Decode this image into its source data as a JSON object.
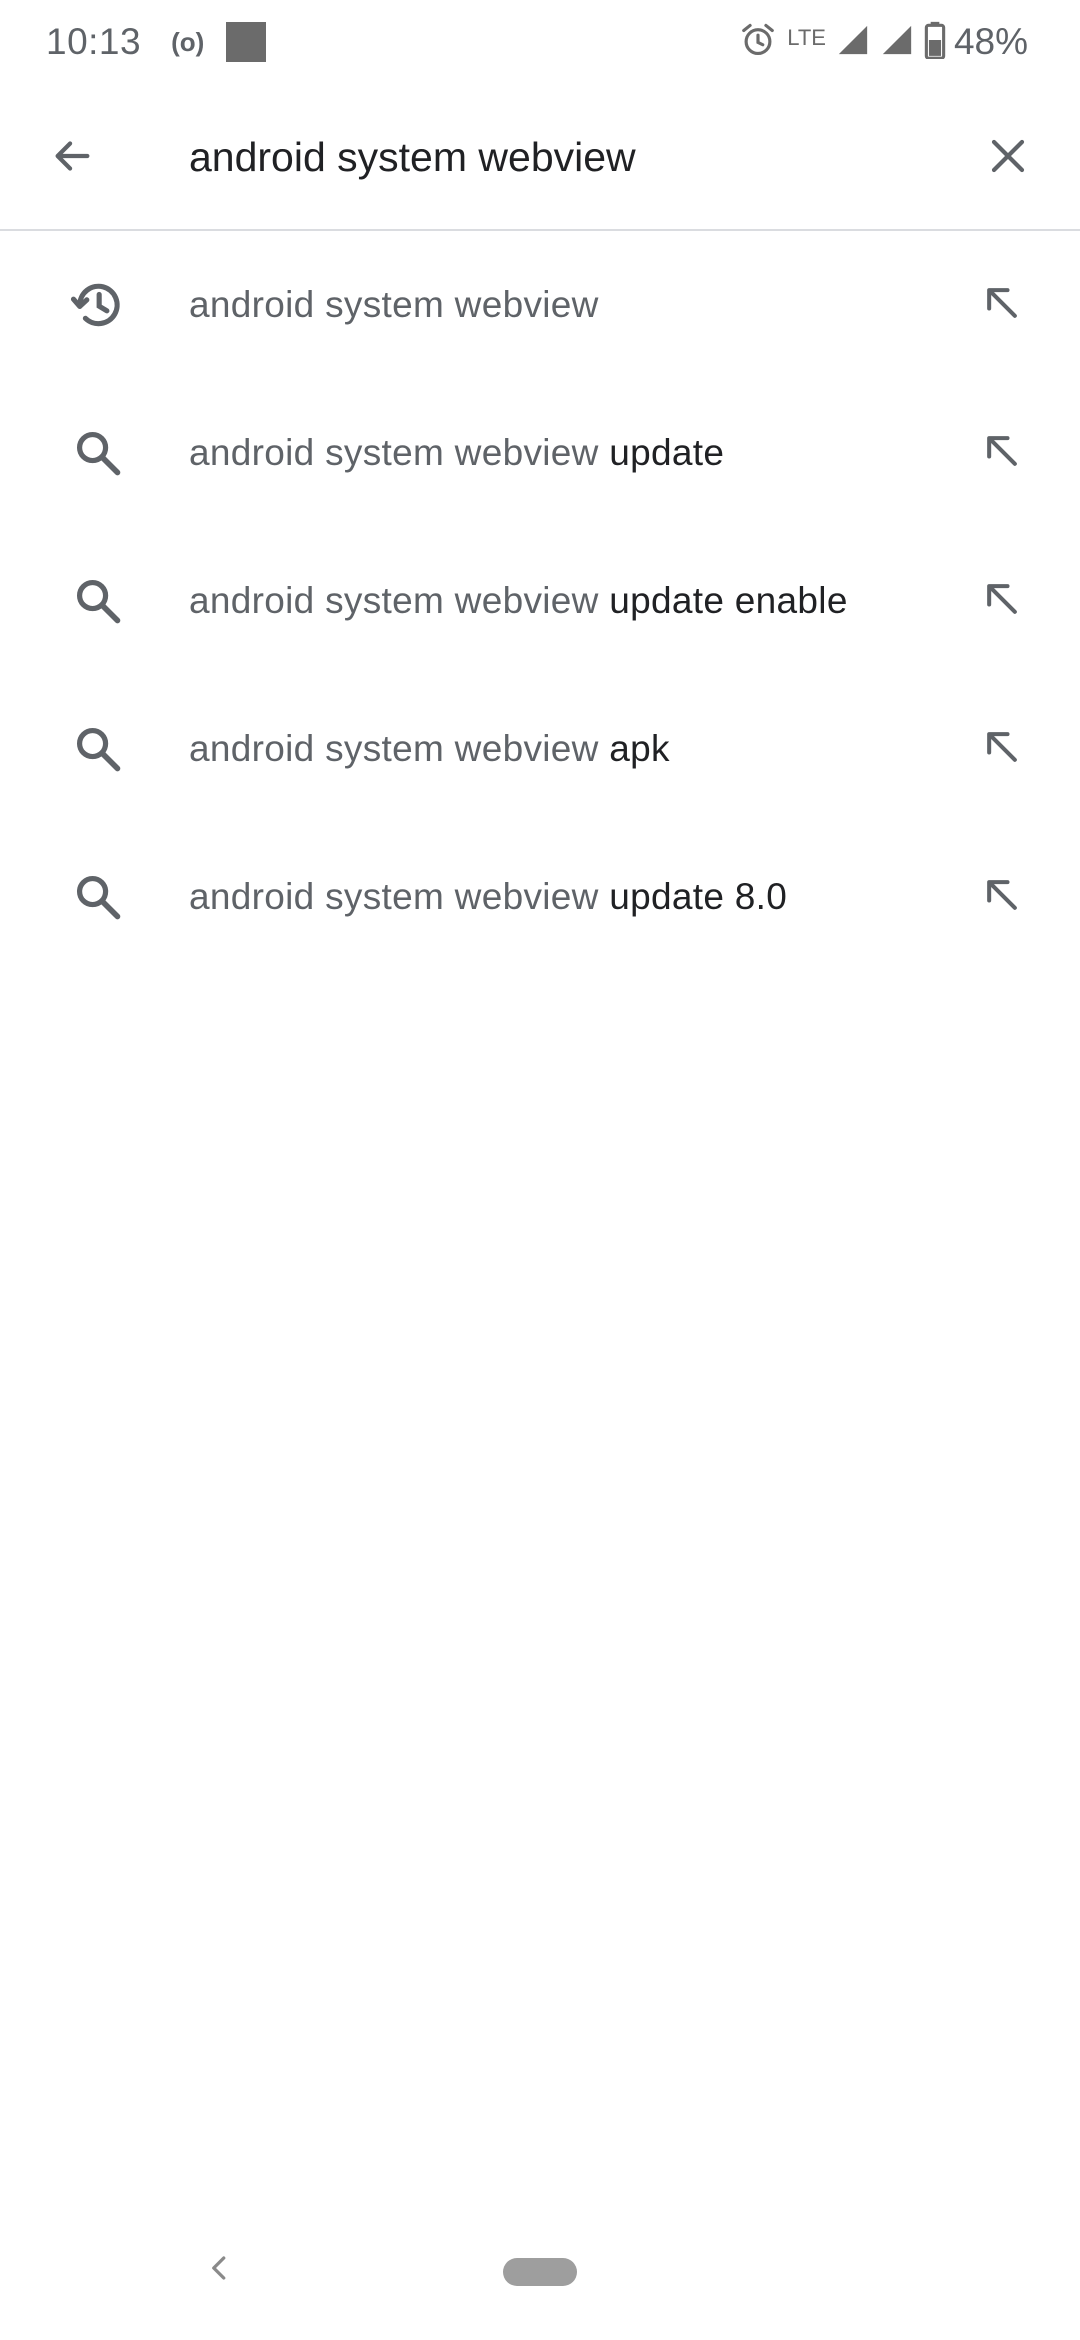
{
  "status_bar": {
    "time": "10:13",
    "hotspot_symbol": "(o)",
    "network": "LTE",
    "battery": "48%",
    "icons": [
      "hotspot-icon",
      "notification-square-icon",
      "alarm-icon",
      "lte-icon",
      "signal-icon",
      "signal-icon",
      "battery-icon"
    ]
  },
  "search": {
    "query": "android system webview",
    "back_icon": "arrow-back-icon",
    "clear_icon": "close-icon"
  },
  "suggestions": [
    {
      "icon": "history-icon",
      "prefix": "android system webview",
      "suffix": ""
    },
    {
      "icon": "search-icon",
      "prefix": "android system webview",
      "suffix": " update"
    },
    {
      "icon": "search-icon",
      "prefix": "android system webview",
      "suffix": " update enable"
    },
    {
      "icon": "search-icon",
      "prefix": "android system webview",
      "suffix": " apk"
    },
    {
      "icon": "search-icon",
      "prefix": "android system webview",
      "suffix": " update 8.0"
    }
  ],
  "nav_bar": {
    "back_icon": "chevron-left-icon",
    "home_icon": "home-pill"
  },
  "colors": {
    "primary_text": "#202124",
    "secondary_text": "#5f6368",
    "icon": "#5f6368",
    "divider": "#dadce0"
  }
}
